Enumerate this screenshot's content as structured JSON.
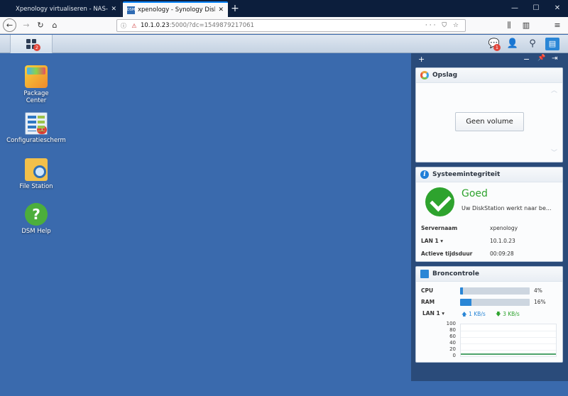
{
  "browser": {
    "tabs": [
      {
        "title": "Xpenology virtualiseren - NAS-cur",
        "favicon": ""
      },
      {
        "title": "xpenology - Synology DiskStation",
        "favicon": "DSM"
      }
    ],
    "url_host": "10.1.0.23",
    "url_path": ":5000/?dc=1549879217061",
    "url_right_glyphs": "··· ⛉ ☆"
  },
  "dsm": {
    "main_menu_badge": "2",
    "notifications_badge": "1"
  },
  "desktop": {
    "icons": [
      {
        "label": "Package\nCenter"
      },
      {
        "label": "Configuratiescherm",
        "badge": "1"
      },
      {
        "label": "File Station"
      },
      {
        "label": "DSM Help"
      }
    ]
  },
  "widgets": {
    "opslag": {
      "title": "Opslag",
      "button": "Geen volume"
    },
    "integriteit": {
      "title": "Systeemintegriteit",
      "status": "Goed",
      "message": "Uw DiskStation werkt naar be...",
      "rows": [
        {
          "key": "Servernaam",
          "value": "xpenology"
        },
        {
          "key": "LAN 1 ▾",
          "value": "10.1.0.23"
        },
        {
          "key": "Actieve tijdsduur",
          "value": "00:09:28"
        }
      ]
    },
    "bron": {
      "title": "Broncontrole",
      "cpu_label": "CPU",
      "cpu_pct": "4%",
      "cpu_value": 4,
      "ram_label": "RAM",
      "ram_pct": "16%",
      "ram_value": 16,
      "lan_label": "LAN 1 ▾",
      "upload": "1 KB/s",
      "download": "3 KB/s",
      "y_ticks": [
        "100",
        "80",
        "60",
        "40",
        "20",
        "0"
      ]
    }
  },
  "colors": {
    "accent": "#2a86d6",
    "ok_green": "#2ea32e",
    "badge_red": "#e0453a",
    "desktop_bg": "#3a6aad"
  }
}
